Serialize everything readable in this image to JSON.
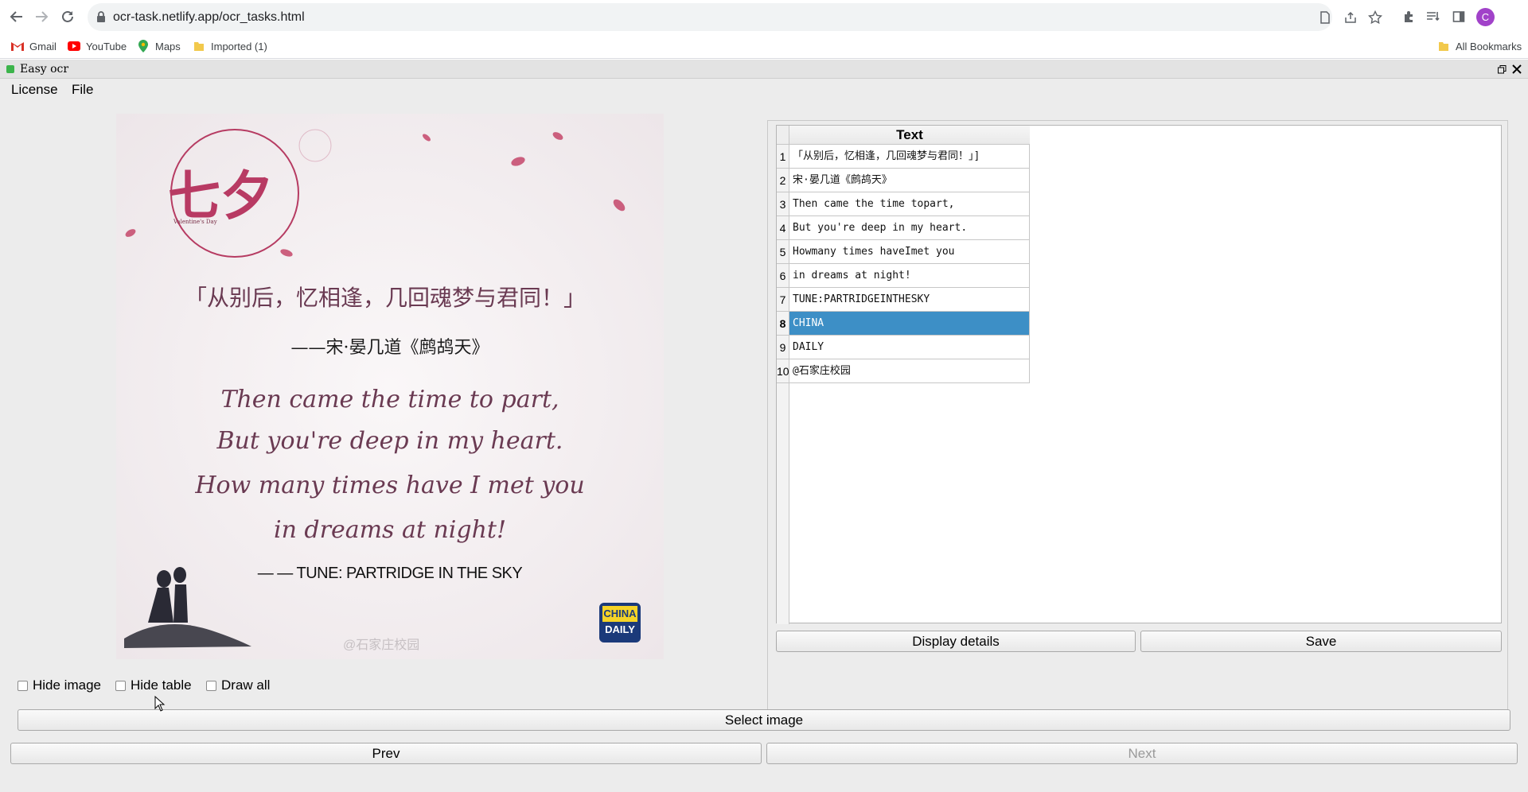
{
  "browser": {
    "url": "ocr-task.netlify.app/ocr_tasks.html",
    "avatar_letter": "C",
    "bookmarks": [
      {
        "label": "Gmail",
        "icon": "gmail-icon"
      },
      {
        "label": "YouTube",
        "icon": "youtube-icon"
      },
      {
        "label": "Maps",
        "icon": "maps-icon"
      },
      {
        "label": "Imported (1)",
        "icon": "folder-icon"
      }
    ],
    "all_bookmarks": "All Bookmarks"
  },
  "app": {
    "title": "Easy ocr",
    "menu": [
      "License",
      "File"
    ]
  },
  "image": {
    "badge_title": "七夕",
    "badge_sub": "Valentine's Day",
    "chinese_line": "「从别后，忆相逢，几回魂梦与君同！」",
    "attribution": "——宋·晏几道《鹧鸪天》",
    "poem": [
      "Then came the time to part,",
      "But you're deep in my heart.",
      "How many times have I met you",
      "in dreams at night!"
    ],
    "tune": "— — TUNE: PARTRIDGE IN THE SKY",
    "watermark": "@石家庄校园",
    "logo_line1": "CHINA",
    "logo_line2": "DAILY"
  },
  "table": {
    "header": "Text",
    "rows": [
      {
        "num": "1",
        "text": "「从别后，忆相逢，几回魂梦与君同！」]"
      },
      {
        "num": "2",
        "text": "宋·晏几道《鹧鸪天》"
      },
      {
        "num": "3",
        "text": "Then came the time topart,"
      },
      {
        "num": "4",
        "text": "But you're deep in my heart."
      },
      {
        "num": "5",
        "text": "Howmany times haveImet you"
      },
      {
        "num": "6",
        "text": "in dreams at night!"
      },
      {
        "num": "7",
        "text": "TUNE:PARTRIDGEINTHESKY"
      },
      {
        "num": "8",
        "text": "CHINA"
      },
      {
        "num": "9",
        "text": "DAILY"
      },
      {
        "num": "10",
        "text": "@石家庄校园"
      }
    ],
    "selected_row": 8
  },
  "buttons": {
    "display_details": "Display details",
    "save": "Save",
    "select_image": "Select image",
    "prev": "Prev",
    "next": "Next"
  },
  "checkboxes": {
    "hide_image": "Hide image",
    "hide_table": "Hide table",
    "draw_all": "Draw all"
  }
}
